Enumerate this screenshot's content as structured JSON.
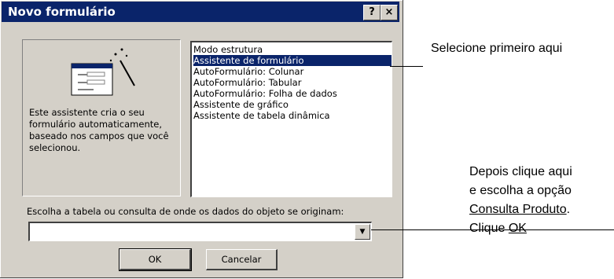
{
  "dialog": {
    "title": "Novo formulário",
    "help_button": "?",
    "close_button": "×",
    "description": "Este assistente cria o seu formulário automaticamente, baseado nos campos que você selecionou.",
    "list_items": [
      "Modo estrutura",
      "Assistente de formulário",
      "AutoFormulário:  Colunar",
      "AutoFormulário:  Tabular",
      "AutoFormulário:  Folha de dados",
      "Assistente de gráfico",
      "Assistente de tabela dinâmica"
    ],
    "selected_index": 1,
    "source_prompt": "Escolha a tabela ou consulta de onde os dados do objeto se originam:",
    "source_value": "",
    "ok_label": "OK",
    "cancel_label": "Cancelar"
  },
  "annotations": {
    "first": "Selecione primeiro aqui",
    "second_line1": "Depois clique aqui",
    "second_line2": "e escolha a opção",
    "second_line3_link": "Consulta Produto",
    "second_line3_end": ".",
    "second_line4_start": "Clique ",
    "second_line4_link": "OK"
  }
}
